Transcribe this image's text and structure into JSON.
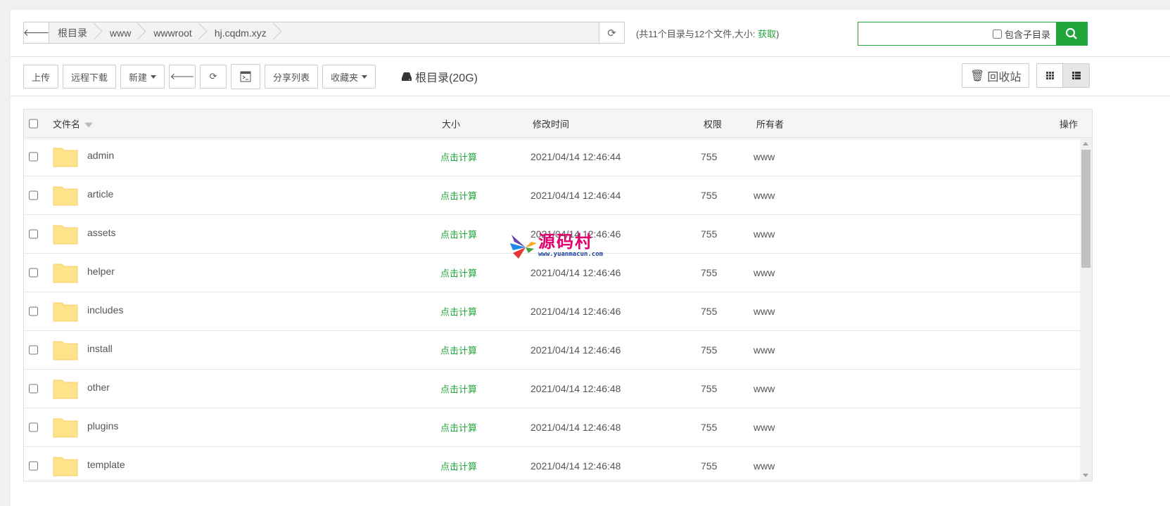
{
  "breadcrumb": {
    "items": [
      "根目录",
      "www",
      "wwwroot",
      "hj.cqdm.xyz"
    ]
  },
  "summary": {
    "text": "(共11个目录与12个文件,大小: ",
    "link": "获取",
    "close": ")"
  },
  "search": {
    "value": "",
    "include_subdir_label": "包含子目录"
  },
  "toolbar": {
    "upload": "上传",
    "remote_download": "远程下载",
    "new": "新建",
    "share_list": "分享列表",
    "favorites": "收藏夹",
    "disk": "根目录(20G)",
    "recycle": "回收站"
  },
  "table": {
    "headers": {
      "name": "文件名",
      "size": "大小",
      "mtime": "修改时间",
      "perm": "权限",
      "owner": "所有者",
      "ops": "操作"
    },
    "rows": [
      {
        "name": "admin",
        "size": "点击计算",
        "mtime": "2021/04/14 12:46:44",
        "perm": "755",
        "owner": "www"
      },
      {
        "name": "article",
        "size": "点击计算",
        "mtime": "2021/04/14 12:46:44",
        "perm": "755",
        "owner": "www"
      },
      {
        "name": "assets",
        "size": "点击计算",
        "mtime": "2021/04/14 12:46:46",
        "perm": "755",
        "owner": "www"
      },
      {
        "name": "helper",
        "size": "点击计算",
        "mtime": "2021/04/14 12:46:46",
        "perm": "755",
        "owner": "www"
      },
      {
        "name": "includes",
        "size": "点击计算",
        "mtime": "2021/04/14 12:46:46",
        "perm": "755",
        "owner": "www"
      },
      {
        "name": "install",
        "size": "点击计算",
        "mtime": "2021/04/14 12:46:46",
        "perm": "755",
        "owner": "www"
      },
      {
        "name": "other",
        "size": "点击计算",
        "mtime": "2021/04/14 12:46:48",
        "perm": "755",
        "owner": "www"
      },
      {
        "name": "plugins",
        "size": "点击计算",
        "mtime": "2021/04/14 12:46:48",
        "perm": "755",
        "owner": "www"
      },
      {
        "name": "template",
        "size": "点击计算",
        "mtime": "2021/04/14 12:46:48",
        "perm": "755",
        "owner": "www"
      }
    ]
  },
  "watermark": {
    "title": "源码村",
    "url": "www.yuanmacun.com"
  },
  "colors": {
    "accent": "#20a53a",
    "folder": "#ffe38a"
  }
}
